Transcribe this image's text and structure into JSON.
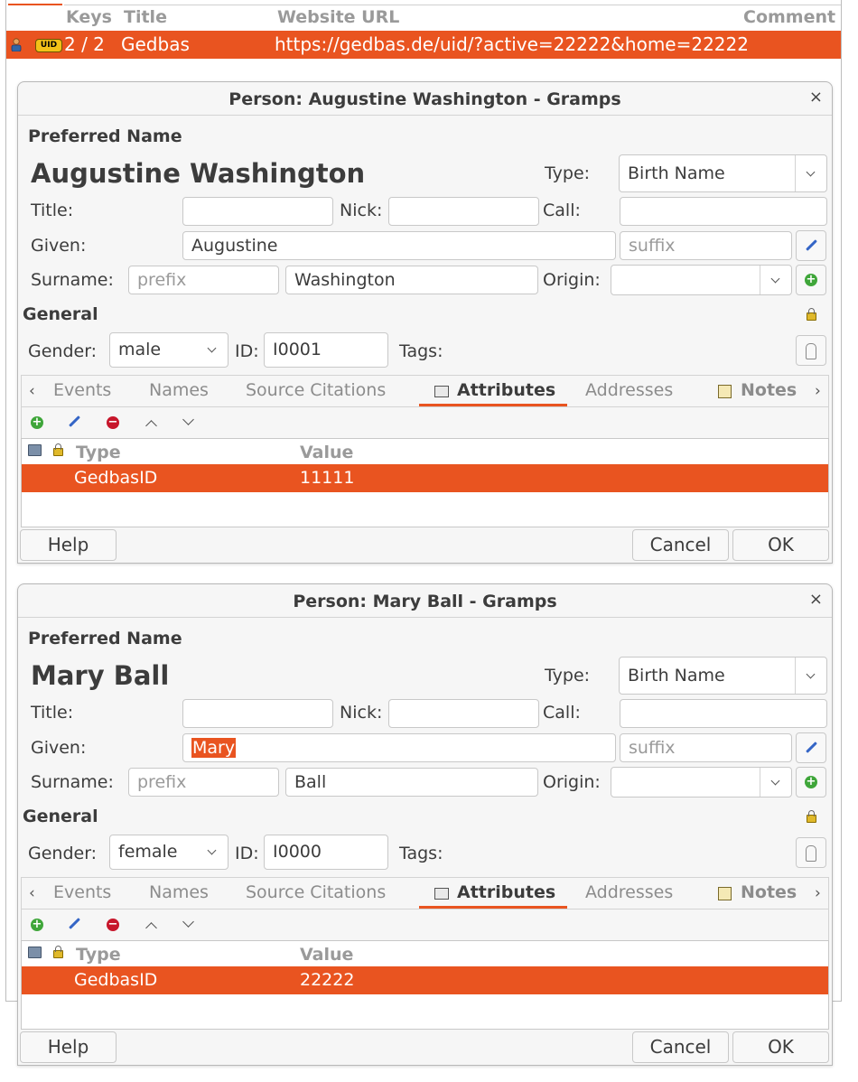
{
  "url_list": {
    "headers": {
      "keys": "Keys",
      "title": "Title",
      "url": "Website URL",
      "comment": "Comment"
    },
    "row": {
      "badge": "UID",
      "keys": "2 / 2",
      "title": "Gedbas",
      "url": "https://gedbas.de/uid/?active=22222&home=22222"
    }
  },
  "dialogs": [
    {
      "title": "Person: Augustine Washington - Gramps",
      "close": "×",
      "preferred_name_label": "Preferred Name",
      "display_name": "Augustine Washington",
      "type_label": "Type:",
      "type_value": "Birth Name",
      "title_label": "Title:",
      "title_value": "",
      "nick_label": "Nick:",
      "nick_value": "",
      "call_label": "Call:",
      "call_value": "",
      "given_label": "Given:",
      "given_value": "Augustine",
      "suffix_placeholder": "suffix",
      "surname_label": "Surname:",
      "prefix_placeholder": "prefix",
      "surname_value": "Washington",
      "origin_label": "Origin:",
      "origin_value": "",
      "general_label": "General",
      "gender_label": "Gender:",
      "gender_value": "male",
      "id_label": "ID:",
      "id_value": "I0001",
      "tags_label": "Tags:",
      "tabs": [
        "Events",
        "Names",
        "Source Citations",
        "Attributes",
        "Addresses",
        "Notes"
      ],
      "active_tab": "Attributes",
      "col_type": "Type",
      "col_value": "Value",
      "attr_type": "GedbasID",
      "attr_value": "11111",
      "help": "Help",
      "cancel": "Cancel",
      "ok": "OK"
    },
    {
      "title": "Person: Mary Ball - Gramps",
      "close": "×",
      "preferred_name_label": "Preferred Name",
      "display_name": "Mary Ball",
      "type_label": "Type:",
      "type_value": "Birth Name",
      "title_label": "Title:",
      "title_value": "",
      "nick_label": "Nick:",
      "nick_value": "",
      "call_label": "Call:",
      "call_value": "",
      "given_label": "Given:",
      "given_value": "Mary",
      "suffix_placeholder": "suffix",
      "surname_label": "Surname:",
      "prefix_placeholder": "prefix",
      "surname_value": "Ball",
      "origin_label": "Origin:",
      "origin_value": "",
      "general_label": "General",
      "gender_label": "Gender:",
      "gender_value": "female",
      "id_label": "ID:",
      "id_value": "I0000",
      "tags_label": "Tags:",
      "tabs": [
        "Events",
        "Names",
        "Source Citations",
        "Attributes",
        "Addresses",
        "Notes"
      ],
      "active_tab": "Attributes",
      "col_type": "Type",
      "col_value": "Value",
      "attr_type": "GedbasID",
      "attr_value": "22222",
      "help": "Help",
      "cancel": "Cancel",
      "ok": "OK"
    }
  ],
  "colors": {
    "accent": "#e95420",
    "badge": "#f3c118",
    "add": "#3fa63a",
    "remove": "#c7162b",
    "edit": "#3465c6"
  }
}
